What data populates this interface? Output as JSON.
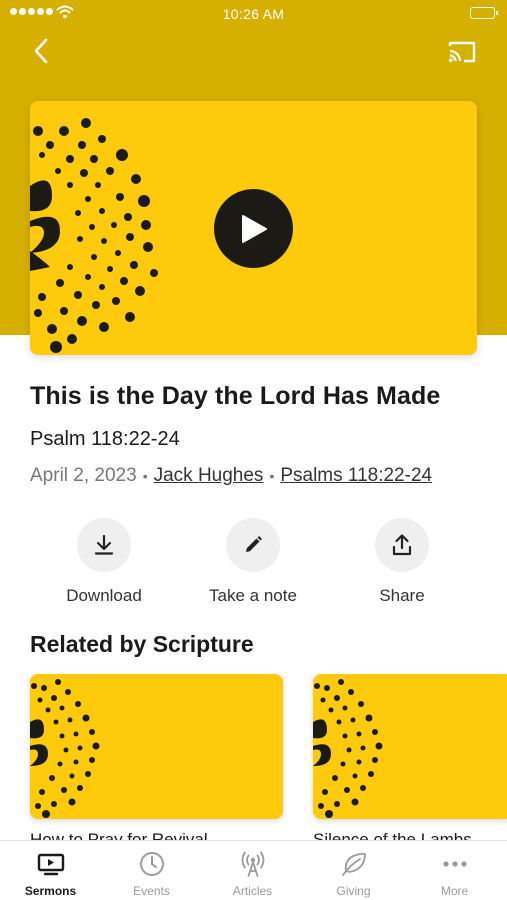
{
  "status_bar": {
    "time": "10:26 AM"
  },
  "sermon": {
    "title": "This is the Day the Lord Has Made",
    "scripture": "Psalm 118:22-24",
    "date": "April 2, 2023",
    "speaker": "Jack Hughes",
    "series": "Psalms 118:22-24"
  },
  "actions": {
    "download": "Download",
    "note": "Take a note",
    "share": "Share"
  },
  "related": {
    "heading": "Related by Scripture",
    "items": [
      {
        "title": "How to Pray for Revival"
      },
      {
        "title": "Silence of the Lambs"
      }
    ]
  },
  "tabs": [
    {
      "label": "Sermons",
      "icon": "tv-icon",
      "active": true
    },
    {
      "label": "Events",
      "icon": "clock-icon",
      "active": false
    },
    {
      "label": "Articles",
      "icon": "broadcast-icon",
      "active": false
    },
    {
      "label": "Giving",
      "icon": "leaf-icon",
      "active": false
    },
    {
      "label": "More",
      "icon": "more-dots-icon",
      "active": false
    }
  ],
  "colors": {
    "header_band": "#d6b000",
    "artwork_yellow": "#fdcb0b",
    "dark": "#1b1a14"
  }
}
